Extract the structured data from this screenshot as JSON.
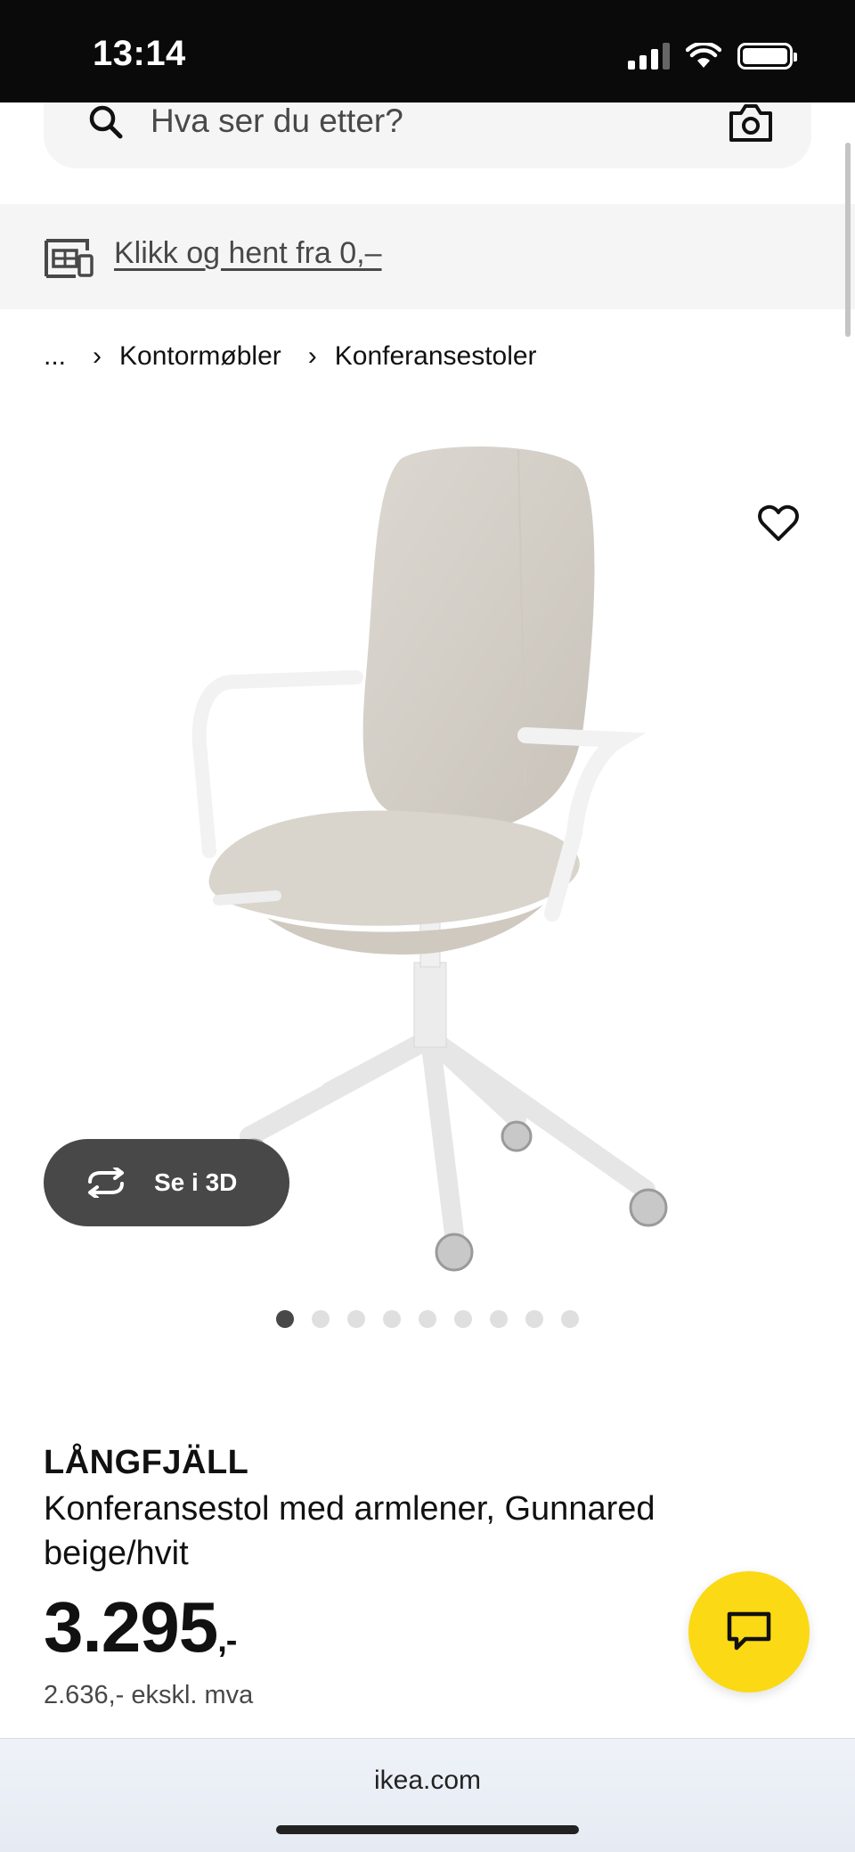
{
  "status_bar": {
    "time": "13:14"
  },
  "search": {
    "placeholder": "Hva ser du etter?"
  },
  "promo": {
    "link_text": "Klikk og hent fra 0,–"
  },
  "breadcrumb": {
    "ellipsis": "...",
    "items": [
      "Kontormøbler",
      "Konferansestoler"
    ]
  },
  "gallery": {
    "view_3d_label": "Se i 3D",
    "total_images": 9,
    "active_index": 0
  },
  "product": {
    "brand": "LÅNGFJÄLL",
    "description": "Konferansestol med armlener, Gunnared beige/hvit",
    "price_main": "3.295",
    "price_suffix": ",-",
    "price_ex_vat": "2.636,- ekskl. mva"
  },
  "browser": {
    "domain": "ikea.com"
  },
  "colors": {
    "accent_yellow": "#fbd914",
    "dark_button": "#484848",
    "fabric": "#d6d1c9"
  },
  "icons": [
    "search-icon",
    "camera-icon",
    "store-icon",
    "chevron-right-icon",
    "heart-icon",
    "rotate-icon",
    "chat-icon"
  ]
}
